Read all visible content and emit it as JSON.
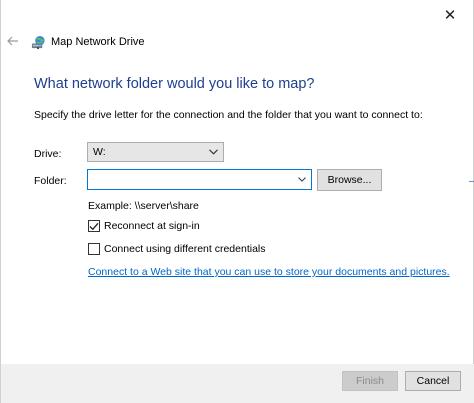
{
  "window": {
    "close_glyph": "✕",
    "back_glyph": "←",
    "title": "Map Network Drive",
    "app_icon": "network-drive-icon"
  },
  "page": {
    "heading": "What network folder would you like to map?",
    "instruction": "Specify the drive letter for the connection and the folder that you want to connect to:"
  },
  "drive": {
    "label": "Drive:",
    "selected": "W:"
  },
  "folder": {
    "label": "Folder:",
    "value": "",
    "placeholder": "",
    "browse_label": "Browse..."
  },
  "example": "Example: \\\\server\\share",
  "options": {
    "reconnect": {
      "label": "Reconnect at sign-in",
      "checked": true
    },
    "credentials": {
      "label": "Connect using different credentials",
      "checked": false
    }
  },
  "link": "Connect to a Web site that you can use to store your documents and pictures.",
  "footer": {
    "finish_label": "Finish",
    "cancel_label": "Cancel"
  },
  "colors": {
    "heading": "#1e3e8f",
    "link": "#0066cc",
    "focus_border": "#0078d7",
    "footer_bg": "#f0f0f0"
  }
}
